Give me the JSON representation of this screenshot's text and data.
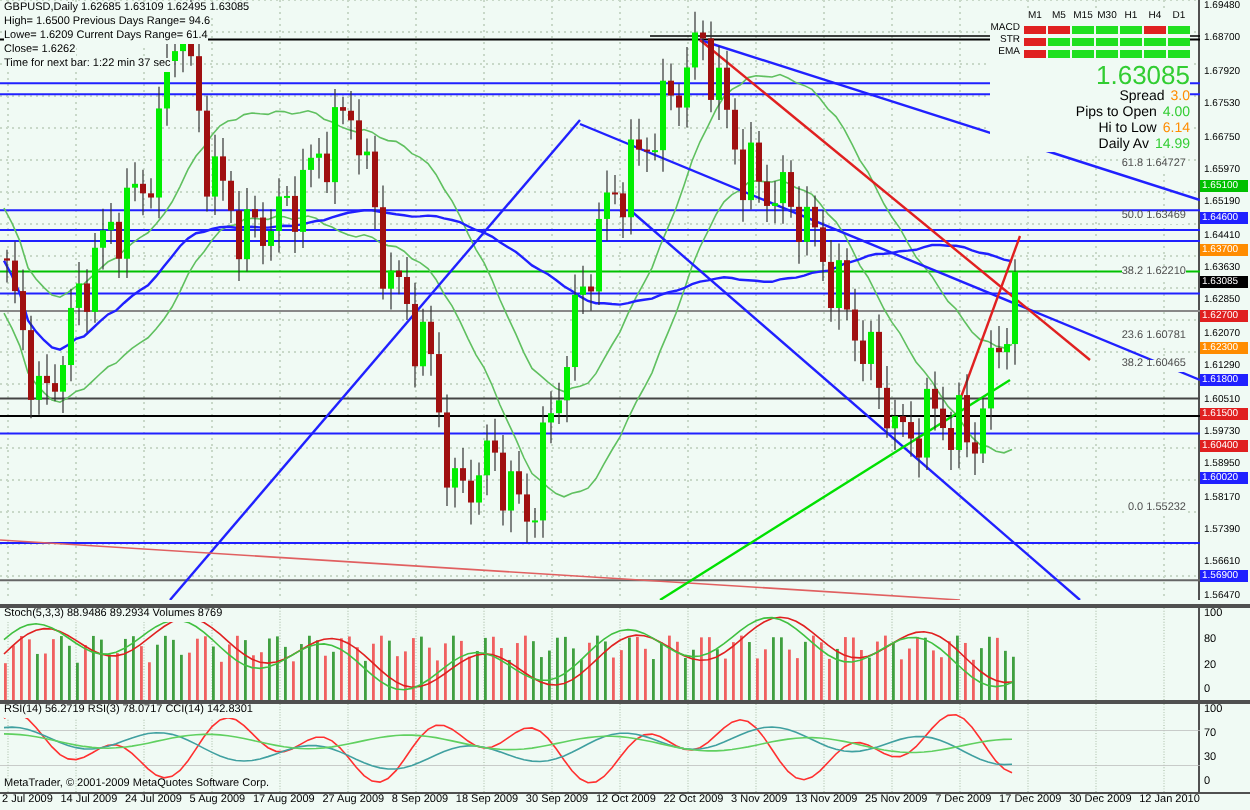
{
  "header": {
    "lines": [
      "GBPUSD,Daily  1.62685 1.63109 1.62495 1.63085",
      "High= 1.6500   Previous Days Range= 94.6",
      "Lowe= 1.6209   Current Days Range= 61.4",
      "Close= 1.6262",
      "Time for next bar: 1:22 min 37 sec"
    ]
  },
  "signal_panel": {
    "timeframes": [
      "M1",
      "M5",
      "M15",
      "M30",
      "H1",
      "H4",
      "D1"
    ],
    "rows": [
      {
        "label": "MACD",
        "signals": [
          false,
          false,
          true,
          true,
          true,
          false,
          true
        ]
      },
      {
        "label": "STR",
        "signals": [
          false,
          true,
          true,
          true,
          true,
          true,
          true
        ]
      },
      {
        "label": "EMA",
        "signals": [
          false,
          true,
          true,
          true,
          true,
          true,
          true
        ]
      }
    ],
    "price": "1.63085",
    "stats": [
      {
        "label": "Spread",
        "value": "3.0",
        "color": "#ff8c00"
      },
      {
        "label": "Pips to Open",
        "value": "4.00",
        "color": "#32cd32"
      },
      {
        "label": "Hi to Low",
        "value": "6.14",
        "color": "#ff8c00"
      },
      {
        "label": "Daily Av",
        "value": "14.99",
        "color": "#32cd32"
      }
    ]
  },
  "fibo_labels": [
    "61.8  1.64727",
    "50.0  1.63469",
    "38.2  1.62210",
    "23.6  1.60781",
    "38.2  1.60465",
    "0.0  1.55232"
  ],
  "price_scale": [
    "1.69480",
    "1.68700",
    "1.67920",
    "1.67530",
    "1.66750",
    "1.65970",
    "1.65190",
    "1.64410",
    "1.63630",
    "1.62850",
    "1.62070",
    "1.61290",
    "1.60510",
    "1.59730",
    "1.58950",
    "1.58170",
    "1.57390",
    "1.56610",
    "1.56470"
  ],
  "price_tags": [
    {
      "text": "1.65100",
      "color": "#00c000"
    },
    {
      "text": "1.64600",
      "color": "#2020ff"
    },
    {
      "text": "1.63700",
      "color": "#ff8c00"
    },
    {
      "text": "1.63085",
      "color": "#000000"
    },
    {
      "text": "1.62700",
      "color": "#e02020"
    },
    {
      "text": "1.62300",
      "color": "#ff8c00"
    },
    {
      "text": "1.61800",
      "color": "#2020ff"
    },
    {
      "text": "1.61500",
      "color": "#e02020"
    },
    {
      "text": "1.60400",
      "color": "#e02020"
    },
    {
      "text": "1.60020",
      "color": "#2020ff"
    },
    {
      "text": "1.56900",
      "color": "#2020ff"
    }
  ],
  "stoch_pane": {
    "label": "Stoch(5,3,3) 88.9486 89.2934  Volumes 8769",
    "scale": [
      "100",
      "80",
      "20",
      "0"
    ]
  },
  "rsi_pane": {
    "label": "RSI(14) 56.2719  RSI(3) 78.0717  CCI(14) 142.8301",
    "scale": [
      "100",
      "70",
      "30",
      "0"
    ]
  },
  "copyright": "MetaTrader, © 2001-2009 MetaQuotes Software Corp.",
  "dates": [
    "2 Jul 2009",
    "14 Jul 2009",
    "24 Jul 2009",
    "5 Aug 2009",
    "17 Aug 2009",
    "27 Aug 2009",
    "8 Sep 2009",
    "18 Sep 2009",
    "30 Sep 2009",
    "12 Oct 2009",
    "22 Oct 2009",
    "3 Nov 2009",
    "13 Nov 2009",
    "25 Nov 2009",
    "7 Dec 2009",
    "17 Dec 2009",
    "30 Dec 2009",
    "12 Jan 2010"
  ]
}
